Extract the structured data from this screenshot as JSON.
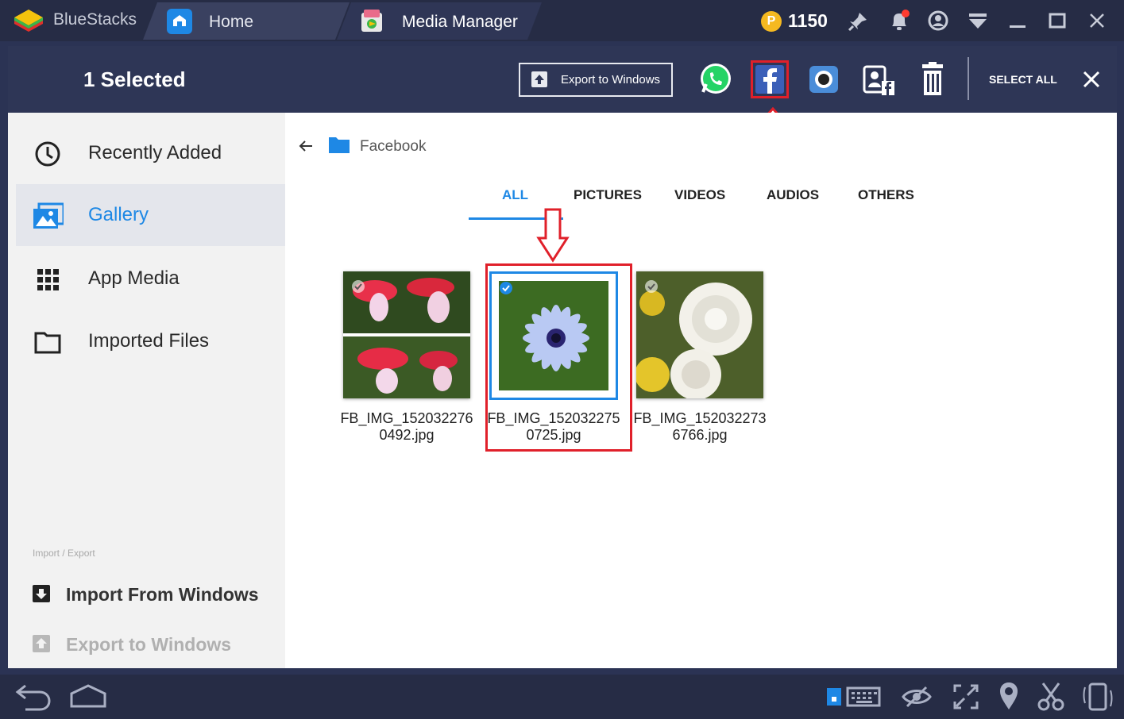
{
  "titlebar": {
    "app_name": "BlueStacks",
    "tabs": [
      {
        "label": "Home"
      },
      {
        "label": "Media Manager"
      }
    ],
    "coins": "1150"
  },
  "header": {
    "selected_text": "1 Selected",
    "export_button": "Export to Windows",
    "select_all": "SELECT ALL"
  },
  "sidebar": {
    "items": [
      {
        "label": "Recently Added",
        "icon": "clock-icon"
      },
      {
        "label": "Gallery",
        "icon": "gallery-icon",
        "active": true
      },
      {
        "label": "App Media",
        "icon": "grid-icon"
      },
      {
        "label": "Imported Files",
        "icon": "folder-icon"
      }
    ],
    "section_label": "Import / Export",
    "import_label": "Import From Windows",
    "export_label": "Export to Windows"
  },
  "content": {
    "folder": "Facebook",
    "tabs": [
      "ALL",
      "PICTURES",
      "VIDEOS",
      "AUDIOS",
      "OTHERS"
    ],
    "active_tab": "ALL",
    "files": [
      {
        "line1": "FB_IMG_152032276",
        "line2": "0492.jpg",
        "selected": false
      },
      {
        "line1": "FB_IMG_152032275",
        "line2": "0725.jpg",
        "selected": true
      },
      {
        "line1": "FB_IMG_152032273",
        "line2": "6766.jpg",
        "selected": false
      }
    ]
  },
  "colors": {
    "accent": "#1e88e5",
    "highlight": "#e0202a",
    "header_bg": "#2e3656",
    "titlebar_bg": "#262c45"
  }
}
